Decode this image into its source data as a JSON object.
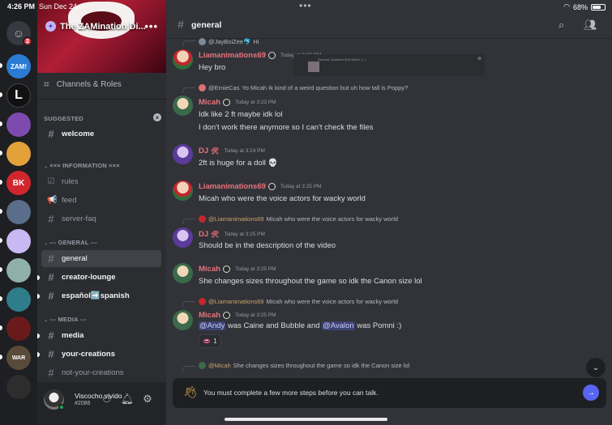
{
  "status": {
    "time": "4:26 PM",
    "date": "Sun Dec 24",
    "battery": "68%",
    "battery_level": 0.68
  },
  "servers": [
    {
      "label": "",
      "color": "#36393f",
      "icon": "friends-icon",
      "badge": "2"
    },
    {
      "label": "ZAM!",
      "color": "#2b7bd3"
    },
    {
      "label": "L",
      "color": "#111111"
    },
    {
      "label": "",
      "color": "#7d4bb0"
    },
    {
      "label": "",
      "color": "#e3a13a"
    },
    {
      "label": "BK",
      "color": "#d2262e"
    },
    {
      "label": "",
      "color": "#5a6d8a"
    },
    {
      "label": "",
      "color": "#c8b8f4"
    },
    {
      "label": "",
      "color": "#8fb0a9"
    },
    {
      "label": "",
      "color": "#2f7d8a"
    },
    {
      "label": "",
      "color": "#6a1a1a"
    },
    {
      "label": "WAR",
      "color": "#5a4a3a"
    },
    {
      "label": "",
      "color": "#2d2d2d"
    }
  ],
  "server": {
    "name": "The ZAMination Di...",
    "more": "•••"
  },
  "sidebar": {
    "channels_roles": "Channels & Roles",
    "suggested": "SUGGESTED",
    "welcome": "welcome",
    "info_section": "××× INFORMATION ×××",
    "rules": "rules",
    "feed": "feed",
    "server_faq": "server-faq",
    "general_section": "--- GENERAL ---",
    "general": "general",
    "creator_lounge": "creator-lounge",
    "espanol": "español➡️spanish",
    "media_section": "--- MEDIA ---",
    "media": "media",
    "your_creations": "your-creations",
    "not_your_creations": "not-your-creations"
  },
  "user": {
    "name": "Viscocho vivido",
    "tag": "#2086"
  },
  "header": {
    "channel": "general"
  },
  "messages": {
    "m0_reply_name": "@JayBoiZee🐬",
    "m0_reply_text": "Hi",
    "m1_name": "Liamanimations69",
    "m1_time": "Today at 3:03 PM",
    "m1_text": "Hey bro",
    "embed_text": "General, Excellent Evil W&W, (...)",
    "m2_reply_name": "@ErnieCas",
    "m2_reply_text": "Yo Micah Ik kind of a weird question but uh how tall is Poppy?",
    "m2_name": "Micah",
    "m2_time": "Today at 3:23 PM",
    "m2_text1": "Idk like 2 ft maybe idk lol",
    "m2_text2": "I don't work there anymore so I can't check the files",
    "m3_name": "DJ",
    "m3_time": "Today at 3:24 PM",
    "m3_text": "2ft is huge for a doll 💀",
    "m4_name": "Liamanimations69",
    "m4_time": "Today at 3:25 PM",
    "m4_text": "Micah who were the voice actors for wacky world",
    "m5_reply_name": "@Liamanimations69",
    "m5_reply_text": "Micah who were the voice actors for wacky world",
    "m5_name": "DJ",
    "m5_time": "Today at 3:25 PM",
    "m5_text": "Should be in the description of the video",
    "m6_name": "Micah",
    "m6_time": "Today at 3:25 PM",
    "m6_text": "She changes sizes throughout the game so idk the Canon size lol",
    "m7_reply_name": "@Liamanimations69",
    "m7_reply_text": "Micah who were the voice actors for wacky world",
    "m7_name": "Micah",
    "m7_time": "Today at 3:25 PM",
    "m7_mention1": "@Andy",
    "m7_text_a": " was Caine and Bubble and ",
    "m7_mention2": "@Avalon",
    "m7_text_b": " was Pomni :)",
    "m7_reaction": "1",
    "m8_reply_name": "@Micah",
    "m8_reply_text": "She changes sizes throughout the game so idk the Canon size lol"
  },
  "notice": {
    "text": "You must complete a few more steps before you can talk."
  },
  "colors": {
    "accent": "#5865f2",
    "liam": "#e8737a",
    "micah": "#e8737a",
    "dj": "#e8737a"
  }
}
